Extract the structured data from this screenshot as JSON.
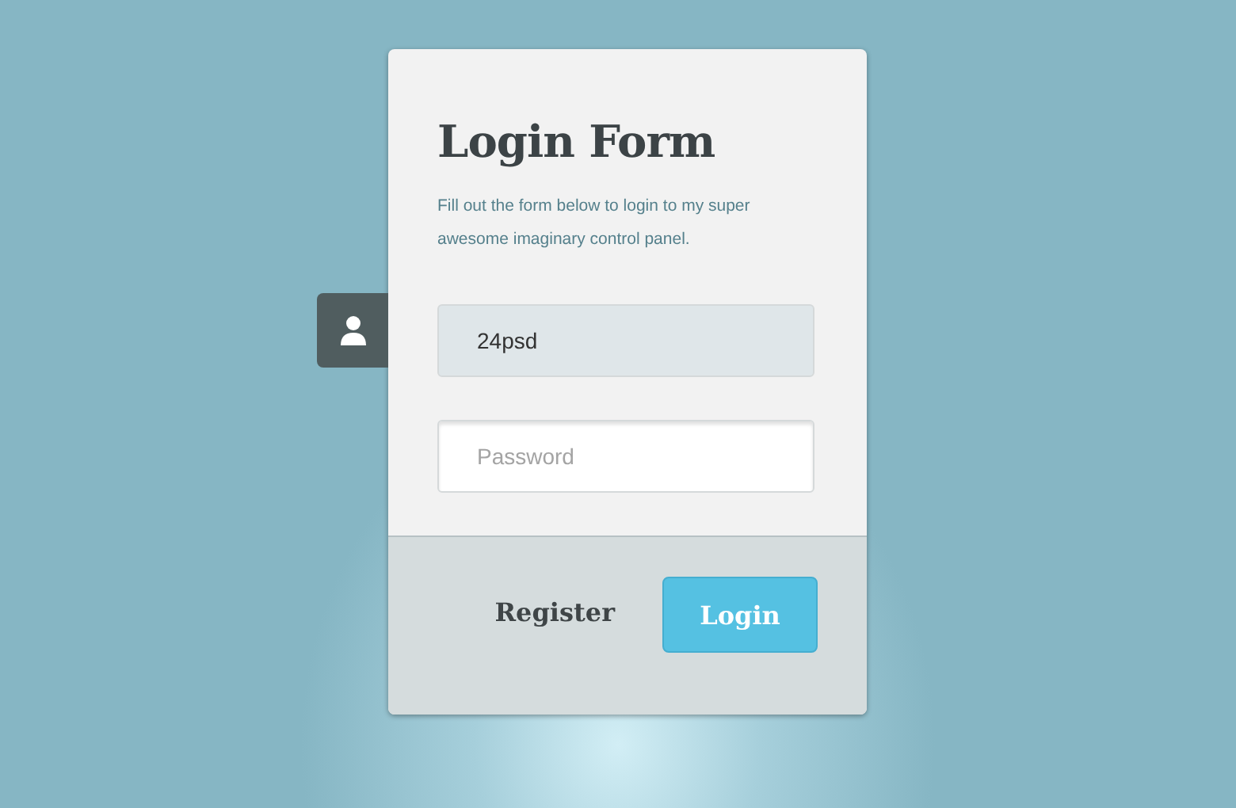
{
  "form": {
    "title": "Login Form",
    "description": "Fill out the form below to login to my super awesome imaginary control panel.",
    "fields": [
      {
        "value": "24psd",
        "focused": true
      },
      {
        "placeholder": "Password",
        "focused": false
      }
    ],
    "register": "Register",
    "login": "Login"
  }
}
